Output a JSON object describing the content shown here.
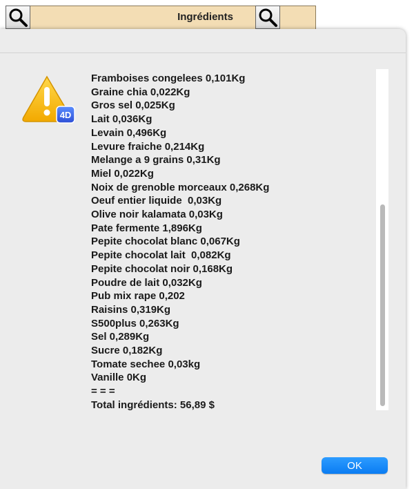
{
  "toolbar": {
    "label": "Ingrédients"
  },
  "dialog": {
    "icon_badge": "4D",
    "lines": [
      "Framboises congelees 0,101Kg",
      "Graine chia 0,022Kg",
      "Gros sel 0,025Kg",
      "Lait 0,036Kg",
      "Levain 0,496Kg",
      "Levure fraiche 0,214Kg",
      "Melange a 9 grains 0,31Kg",
      "Miel 0,022Kg",
      "Noix de grenoble morceaux 0,268Kg",
      "Oeuf entier liquide  0,03Kg",
      "Olive noir kalamata 0,03Kg",
      "Pate fermente 1,896Kg",
      "Pepite chocolat blanc 0,067Kg",
      "Pepite chocolat lait  0,082Kg",
      "Pepite chocolat noir 0,168Kg",
      "Poudre de lait 0,032Kg",
      "Pub mix rape 0,202",
      "Raisins 0,319Kg",
      "S500plus 0,263Kg",
      "Sel 0,289Kg",
      "Sucre 0,182Kg",
      "Tomate sechee 0,03kg",
      "Vanille 0Kg",
      "= = =",
      "Total ingrédients: 56,89 $"
    ],
    "ok_label": "OK"
  }
}
